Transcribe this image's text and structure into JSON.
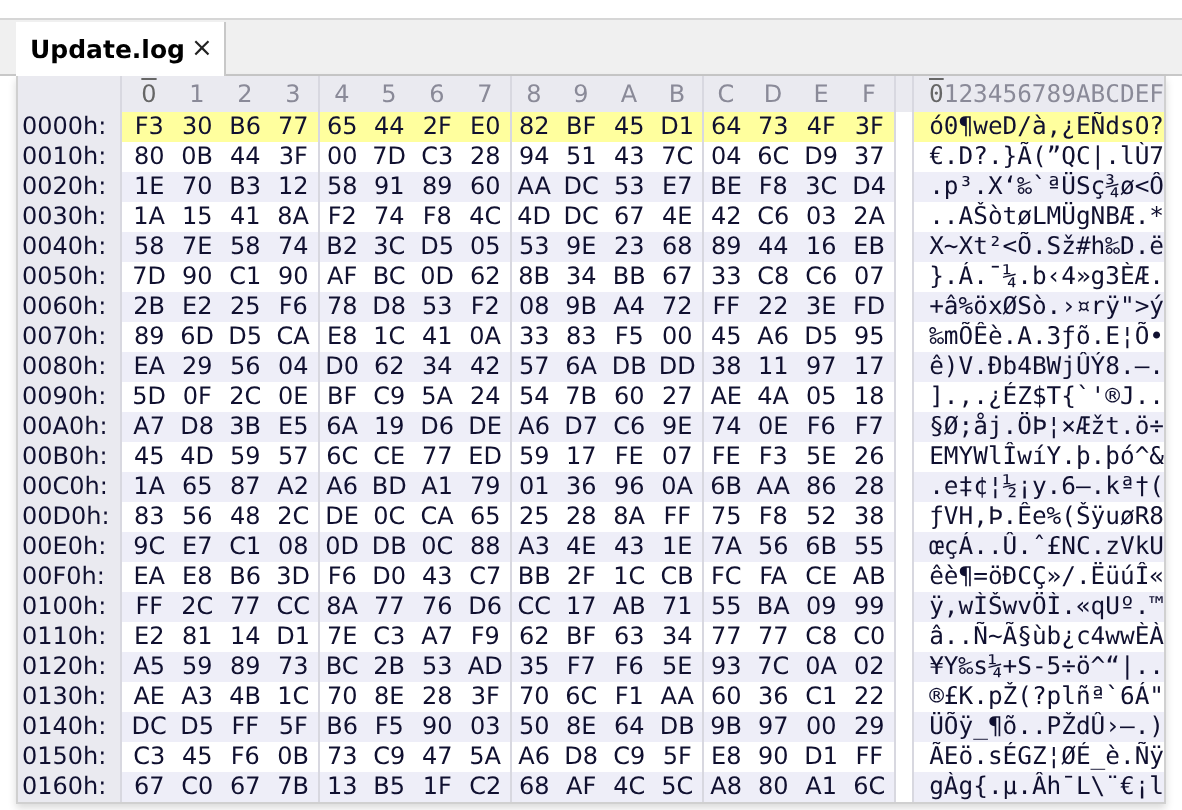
{
  "tab": {
    "label": "Update.log",
    "close": "×",
    "selected": true
  },
  "columns": [
    {
      "label": "0",
      "selected": true
    },
    {
      "label": "1",
      "selected": false
    },
    {
      "label": "2",
      "selected": false
    },
    {
      "label": "3",
      "selected": false
    },
    {
      "label": "4",
      "selected": false
    },
    {
      "label": "5",
      "selected": false
    },
    {
      "label": "6",
      "selected": false
    },
    {
      "label": "7",
      "selected": false
    },
    {
      "label": "8",
      "selected": false
    },
    {
      "label": "9",
      "selected": false
    },
    {
      "label": "A",
      "selected": false
    },
    {
      "label": "B",
      "selected": false
    },
    {
      "label": "C",
      "selected": false
    },
    {
      "label": "D",
      "selected": false
    },
    {
      "label": "E",
      "selected": false
    },
    {
      "label": "F",
      "selected": false
    }
  ],
  "ascii_header": "0123456789ABCDEF",
  "rows": [
    {
      "offset": "0000h:",
      "selected": true,
      "bytes": [
        "F3",
        "30",
        "B6",
        "77",
        "65",
        "44",
        "2F",
        "E0",
        "82",
        "BF",
        "45",
        "D1",
        "64",
        "73",
        "4F",
        "3F"
      ],
      "ascii": "ó0¶weD/à‚¿EÑdsO?"
    },
    {
      "offset": "0010h:",
      "selected": false,
      "bytes": [
        "80",
        "0B",
        "44",
        "3F",
        "00",
        "7D",
        "C3",
        "28",
        "94",
        "51",
        "43",
        "7C",
        "04",
        "6C",
        "D9",
        "37"
      ],
      "ascii": "€.D?.}Ã(”QC|.lÙ7"
    },
    {
      "offset": "0020h:",
      "selected": false,
      "bytes": [
        "1E",
        "70",
        "B3",
        "12",
        "58",
        "91",
        "89",
        "60",
        "AA",
        "DC",
        "53",
        "E7",
        "BE",
        "F8",
        "3C",
        "D4"
      ],
      "ascii": ".p³.X‘‰`ªÜSç¾ø<Ô"
    },
    {
      "offset": "0030h:",
      "selected": false,
      "bytes": [
        "1A",
        "15",
        "41",
        "8A",
        "F2",
        "74",
        "F8",
        "4C",
        "4D",
        "DC",
        "67",
        "4E",
        "42",
        "C6",
        "03",
        "2A"
      ],
      "ascii": "..AŠòtøLMÜgNBÆ.*"
    },
    {
      "offset": "0040h:",
      "selected": false,
      "bytes": [
        "58",
        "7E",
        "58",
        "74",
        "B2",
        "3C",
        "D5",
        "05",
        "53",
        "9E",
        "23",
        "68",
        "89",
        "44",
        "16",
        "EB"
      ],
      "ascii": "X~Xt²<Õ.Sž#h‰D.ë"
    },
    {
      "offset": "0050h:",
      "selected": false,
      "bytes": [
        "7D",
        "90",
        "C1",
        "90",
        "AF",
        "BC",
        "0D",
        "62",
        "8B",
        "34",
        "BB",
        "67",
        "33",
        "C8",
        "C6",
        "07"
      ],
      "ascii": "}.Á.¯¼.b‹4»g3ÈÆ."
    },
    {
      "offset": "0060h:",
      "selected": false,
      "bytes": [
        "2B",
        "E2",
        "25",
        "F6",
        "78",
        "D8",
        "53",
        "F2",
        "08",
        "9B",
        "A4",
        "72",
        "FF",
        "22",
        "3E",
        "FD"
      ],
      "ascii": "+â%öxØSò.›¤rÿ\">ý"
    },
    {
      "offset": "0070h:",
      "selected": false,
      "bytes": [
        "89",
        "6D",
        "D5",
        "CA",
        "E8",
        "1C",
        "41",
        "0A",
        "33",
        "83",
        "F5",
        "00",
        "45",
        "A6",
        "D5",
        "95"
      ],
      "ascii": "‰mÕÊè.A.3ƒõ.E¦Õ•"
    },
    {
      "offset": "0080h:",
      "selected": false,
      "bytes": [
        "EA",
        "29",
        "56",
        "04",
        "D0",
        "62",
        "34",
        "42",
        "57",
        "6A",
        "DB",
        "DD",
        "38",
        "11",
        "97",
        "17"
      ],
      "ascii": "ê)V.Ðb4BWjÛÝ8.—."
    },
    {
      "offset": "0090h:",
      "selected": false,
      "bytes": [
        "5D",
        "0F",
        "2C",
        "0E",
        "BF",
        "C9",
        "5A",
        "24",
        "54",
        "7B",
        "60",
        "27",
        "AE",
        "4A",
        "05",
        "18"
      ],
      "ascii": "].,.¿ÉZ$T{`'®J.."
    },
    {
      "offset": "00A0h:",
      "selected": false,
      "bytes": [
        "A7",
        "D8",
        "3B",
        "E5",
        "6A",
        "19",
        "D6",
        "DE",
        "A6",
        "D7",
        "C6",
        "9E",
        "74",
        "0E",
        "F6",
        "F7"
      ],
      "ascii": "§Ø;åj.ÖÞ¦×Æžt.ö÷"
    },
    {
      "offset": "00B0h:",
      "selected": false,
      "bytes": [
        "45",
        "4D",
        "59",
        "57",
        "6C",
        "CE",
        "77",
        "ED",
        "59",
        "17",
        "FE",
        "07",
        "FE",
        "F3",
        "5E",
        "26"
      ],
      "ascii": "EMYWlÎwíY.þ.þó^&"
    },
    {
      "offset": "00C0h:",
      "selected": false,
      "bytes": [
        "1A",
        "65",
        "87",
        "A2",
        "A6",
        "BD",
        "A1",
        "79",
        "01",
        "36",
        "96",
        "0A",
        "6B",
        "AA",
        "86",
        "28"
      ],
      "ascii": ".e‡¢¦½¡y.6–.kª†("
    },
    {
      "offset": "00D0h:",
      "selected": false,
      "bytes": [
        "83",
        "56",
        "48",
        "2C",
        "DE",
        "0C",
        "CA",
        "65",
        "25",
        "28",
        "8A",
        "FF",
        "75",
        "F8",
        "52",
        "38"
      ],
      "ascii": "ƒVH,Þ.Êe%(ŠÿuøR8"
    },
    {
      "offset": "00E0h:",
      "selected": false,
      "bytes": [
        "9C",
        "E7",
        "C1",
        "08",
        "0D",
        "DB",
        "0C",
        "88",
        "A3",
        "4E",
        "43",
        "1E",
        "7A",
        "56",
        "6B",
        "55"
      ],
      "ascii": "œçÁ..Û.ˆ£NC.zVkU"
    },
    {
      "offset": "00F0h:",
      "selected": false,
      "bytes": [
        "EA",
        "E8",
        "B6",
        "3D",
        "F6",
        "D0",
        "43",
        "C7",
        "BB",
        "2F",
        "1C",
        "CB",
        "FC",
        "FA",
        "CE",
        "AB"
      ],
      "ascii": "êè¶=öÐCÇ»/.ËüúÎ«"
    },
    {
      "offset": "0100h:",
      "selected": false,
      "bytes": [
        "FF",
        "2C",
        "77",
        "CC",
        "8A",
        "77",
        "76",
        "D6",
        "CC",
        "17",
        "AB",
        "71",
        "55",
        "BA",
        "09",
        "99"
      ],
      "ascii": "ÿ,wÌŠwvÖÌ.«qUº.™"
    },
    {
      "offset": "0110h:",
      "selected": false,
      "bytes": [
        "E2",
        "81",
        "14",
        "D1",
        "7E",
        "C3",
        "A7",
        "F9",
        "62",
        "BF",
        "63",
        "34",
        "77",
        "77",
        "C8",
        "C0"
      ],
      "ascii": [
        "â",
        ".",
        ".",
        "Ñ",
        "~",
        "Ã",
        "§",
        "ù",
        "b",
        "¿",
        "c",
        "4",
        "w",
        "w",
        "È",
        "À"
      ]
    },
    {
      "offset": "0120h:",
      "selected": false,
      "bytes": [
        "A5",
        "59",
        "89",
        "73",
        "BC",
        "2B",
        "53",
        "AD",
        "35",
        "F7",
        "F6",
        "5E",
        "93",
        "7C",
        "0A",
        "02"
      ],
      "ascii": "¥Y‰s¼+S-5÷ö^“|.."
    },
    {
      "offset": "0130h:",
      "selected": false,
      "bytes": [
        "AE",
        "A3",
        "4B",
        "1C",
        "70",
        "8E",
        "28",
        "3F",
        "70",
        "6C",
        "F1",
        "AA",
        "60",
        "36",
        "C1",
        "22"
      ],
      "ascii": "®£K.pŽ(?plñª`6Á\""
    },
    {
      "offset": "0140h:",
      "selected": false,
      "bytes": [
        "DC",
        "D5",
        "FF",
        "5F",
        "B6",
        "F5",
        "90",
        "03",
        "50",
        "8E",
        "64",
        "DB",
        "9B",
        "97",
        "00",
        "29"
      ],
      "ascii": "ÜÕÿ_¶õ..PŽdÛ›—.)"
    },
    {
      "offset": "0150h:",
      "selected": false,
      "bytes": [
        "C3",
        "45",
        "F6",
        "0B",
        "73",
        "C9",
        "47",
        "5A",
        "A6",
        "D8",
        "C9",
        "5F",
        "E8",
        "90",
        "D1",
        "FF"
      ],
      "ascii": "ÃEö.sÉGZ¦ØÉ_è.Ñÿ"
    },
    {
      "offset": "0160h:",
      "selected": false,
      "bytes": [
        "67",
        "C0",
        "67",
        "7B",
        "13",
        "B5",
        "1F",
        "C2",
        "68",
        "AF",
        "4C",
        "5C",
        "A8",
        "80",
        "A1",
        "6C"
      ],
      "ascii": "gÀg{.µ.Âh¯L\\¨€¡l"
    }
  ]
}
